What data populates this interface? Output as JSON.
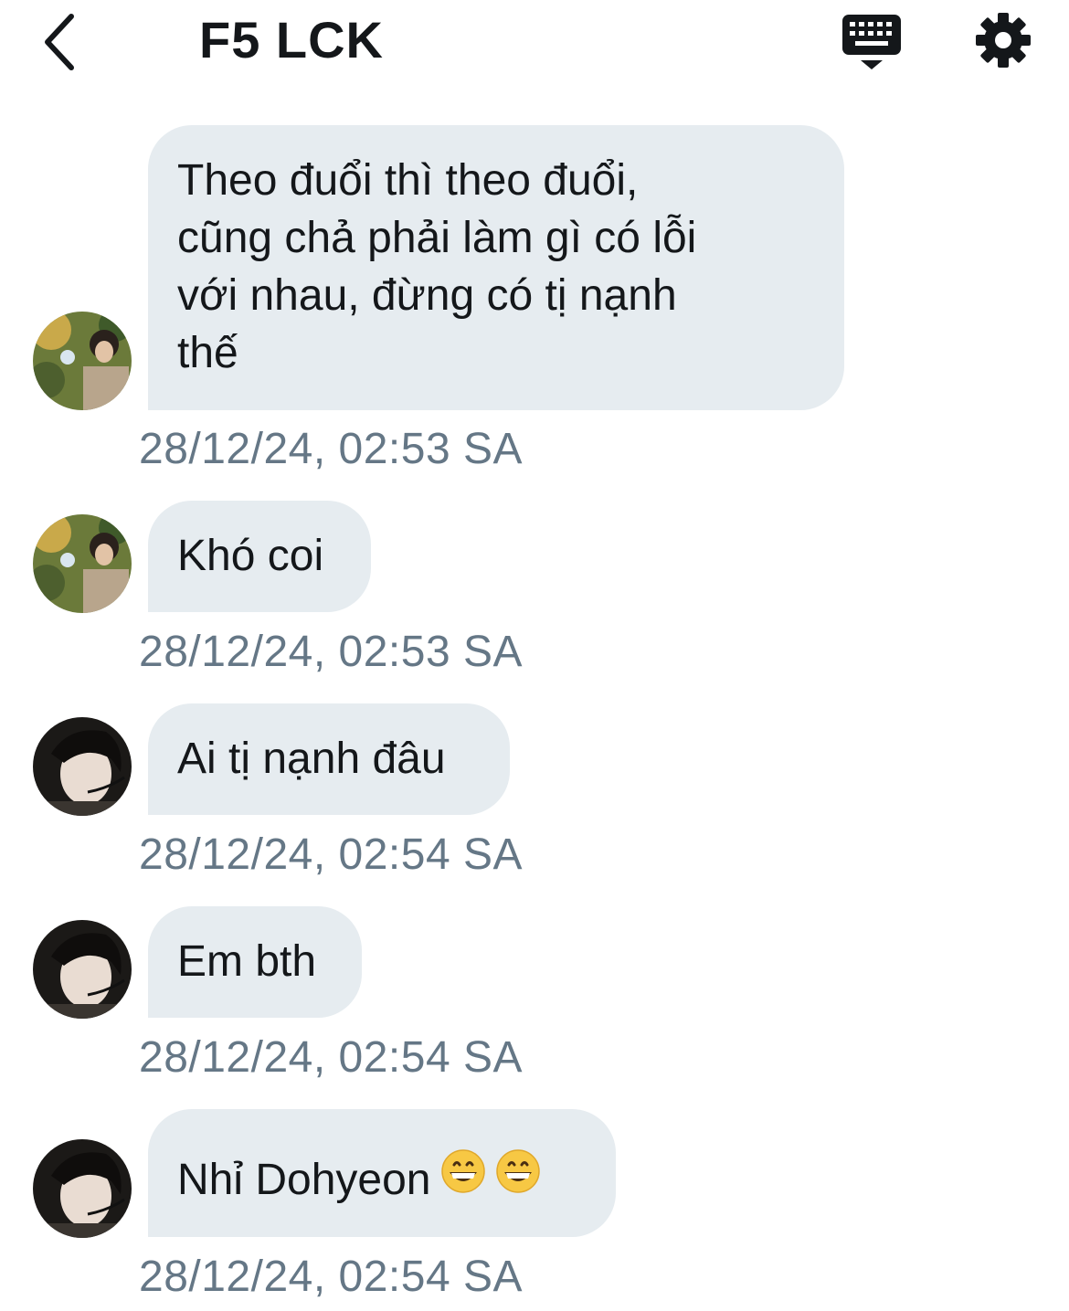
{
  "header": {
    "back_icon": "chevron-left-icon",
    "title": "F5 LCK",
    "keyboard_icon": "keyboard-icon",
    "settings_icon": "gear-icon"
  },
  "colors": {
    "bubble_bg": "#e6ecf0",
    "timestamp": "#657786",
    "text": "#14171a"
  },
  "messages": [
    {
      "sender_avatar": "avatar-user-1",
      "lines": [
        "Theo đuổi thì theo đuổi,",
        "cũng chả phải làm gì có lỗi",
        "với nhau, đừng có tị nạnh",
        "thế"
      ],
      "timestamp": "28/12/24, 02:53 SA"
    },
    {
      "sender_avatar": "avatar-user-1",
      "text": "Khó coi",
      "timestamp": "28/12/24, 02:53 SA"
    },
    {
      "sender_avatar": "avatar-user-2",
      "text": "Ai tị nạnh đâu",
      "timestamp": "28/12/24, 02:54 SA"
    },
    {
      "sender_avatar": "avatar-user-2",
      "text": "Em bth",
      "timestamp": "28/12/24, 02:54 SA"
    },
    {
      "sender_avatar": "avatar-user-2",
      "text": "Nhỉ Dohyeon",
      "emojis": [
        "grinning-face-icon",
        "grinning-face-icon"
      ],
      "timestamp": "28/12/24, 02:54 SA"
    }
  ]
}
